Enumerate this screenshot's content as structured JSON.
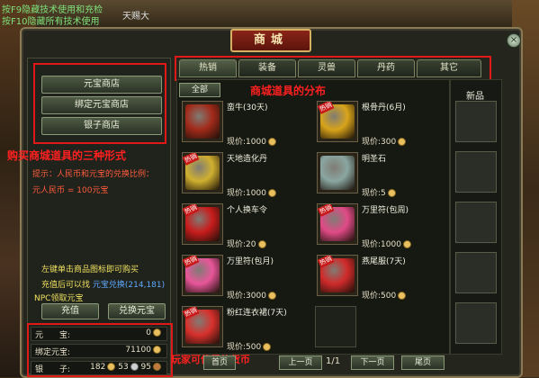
{
  "chat": {
    "line1": "按F9隐藏技术使用和充检",
    "line2": "按F10隐藏所有技术使用"
  },
  "top_tag": "天赐大",
  "window": {
    "title": "商城",
    "close_icon": "×"
  },
  "left": {
    "store_buttons": [
      "元宝商店",
      "绑定元宝商店",
      "银子商店"
    ],
    "annotation_stores": "购买商城道具的三种形式",
    "tip_line1": "提示：人民币和元宝的兑换比例：",
    "tip_line2": "元人民币 = 100元宝",
    "help_line1": "左键单击商品图标即可购买",
    "help_line2_prefix": "充值后可以找",
    "help_link": "元宝兑换(214,181)",
    "help_line3": "NPC领取元宝",
    "recharge_label": "充值",
    "exchange_label": "兑换元宝",
    "money": {
      "yuanbao_label": "元　　宝:",
      "yuanbao_value": "0",
      "bound_label": "绑定元宝:",
      "bound_value": "71100",
      "silver_label": "银　　子:",
      "silver_gold": "182",
      "silver_silver": "53",
      "silver_copper": "95"
    },
    "annotation_money": "玩家可使用的货币"
  },
  "tabs": [
    "热销",
    "装备",
    "灵兽",
    "丹药",
    "其它"
  ],
  "annotation_distribution": "商城道具的分布",
  "all_label": "全部",
  "hot_badge": "热销",
  "items": [
    {
      "name": "蛮牛(30天)",
      "price": "现价:1000",
      "color": "#a22a1a",
      "hot": false
    },
    {
      "name": "根骨丹(6月)",
      "price": "现价:300",
      "color": "#d8a41a",
      "hot": true
    },
    {
      "name": "天地造化丹",
      "price": "现价:1000",
      "color": "#d0b030",
      "hot": true
    },
    {
      "name": "明圣石",
      "price": "现价:5",
      "color": "#8aa6a0",
      "hot": false
    },
    {
      "name": "个人换车令",
      "price": "现价:20",
      "color": "#c81c1c",
      "hot": true
    },
    {
      "name": "万里符(包周)",
      "price": "现价:1000",
      "color": "#e04a86",
      "hot": true
    },
    {
      "name": "万里符(包月)",
      "price": "现价:3000",
      "color": "#e8569a",
      "hot": true
    },
    {
      "name": "燕尾服(7天)",
      "price": "现价:500",
      "color": "#d02a2a",
      "hot": true
    },
    {
      "name": "粉红连衣裙(7天)",
      "price": "现价:500",
      "color": "#d8302c",
      "hot": true
    }
  ],
  "new_title": "新品",
  "pager": {
    "prev_label": "上一页",
    "next_label": "下一页",
    "last_label": "尾页",
    "page": "1/1",
    "first_label": "首页"
  },
  "colors": {
    "annotation_red": "#e01818",
    "frame": "#8a7a56",
    "hot_red": "#c81818"
  }
}
